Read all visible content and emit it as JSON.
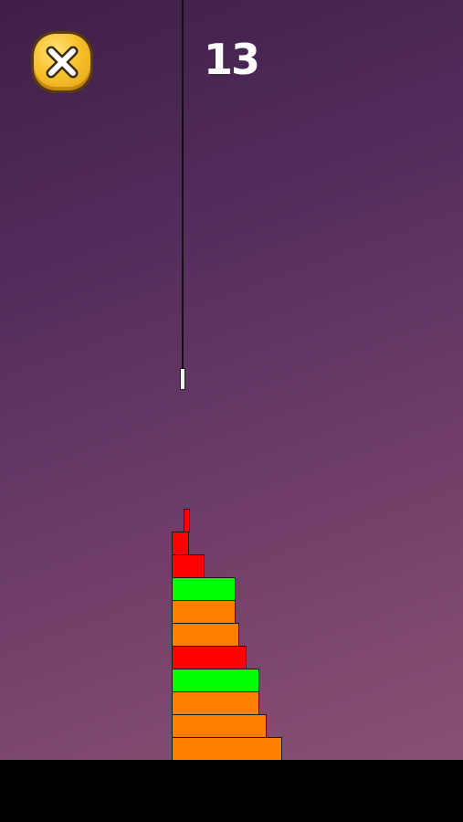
{
  "hud": {
    "score": "13",
    "close_icon": "close-x-icon"
  },
  "colors": {
    "sky_top": "#3f1f48",
    "sky_bottom": "#8e5478",
    "ground": "#000000",
    "button_yellow": "#f7c22d",
    "block_orange": "#ff7f00",
    "block_green": "#00ff00",
    "block_red": "#ff0000",
    "hanging_block": "#f2f2f2"
  },
  "tower": {
    "blocks": [
      {
        "color": "red"
      },
      {
        "color": "red"
      },
      {
        "color": "red"
      },
      {
        "color": "green"
      },
      {
        "color": "orange"
      },
      {
        "color": "orange"
      },
      {
        "color": "red"
      },
      {
        "color": "green"
      },
      {
        "color": "orange"
      },
      {
        "color": "orange"
      },
      {
        "color": "orange"
      }
    ]
  }
}
